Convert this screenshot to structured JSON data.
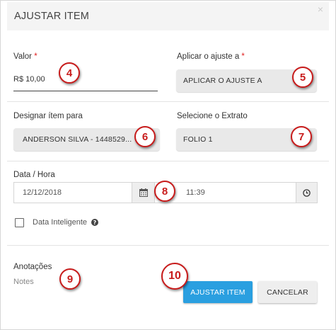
{
  "modal": {
    "title": "AJUSTAR ITEM",
    "close": "×"
  },
  "form": {
    "valor": {
      "label": "Valor",
      "required": "*",
      "value": "R$ 10,00"
    },
    "aplicar": {
      "label": "Aplicar o ajuste a",
      "required": "*",
      "value": "APLICAR O AJUSTE A"
    },
    "designar": {
      "label": "Designar ítem para",
      "value": "ANDERSON SILVA - 1448529..."
    },
    "extrato": {
      "label": "Selecione o Extrato",
      "value": "FOLIO 1"
    },
    "datahora": {
      "label": "Data / Hora",
      "date": "12/12/2018",
      "time": "11:39"
    },
    "inteligente": {
      "label": "Data Inteligente",
      "help": "?"
    },
    "anotacoes": {
      "label": "Anotações",
      "placeholder": "Notes"
    }
  },
  "buttons": {
    "submit": "AJUSTAR ITEM",
    "cancel": "CANCELAR"
  },
  "annotations": [
    "4",
    "5",
    "6",
    "7",
    "8",
    "9",
    "10"
  ],
  "colors": {
    "primary": "#2a9fe0",
    "badge": "#c81b1b",
    "required": "#e02020"
  }
}
